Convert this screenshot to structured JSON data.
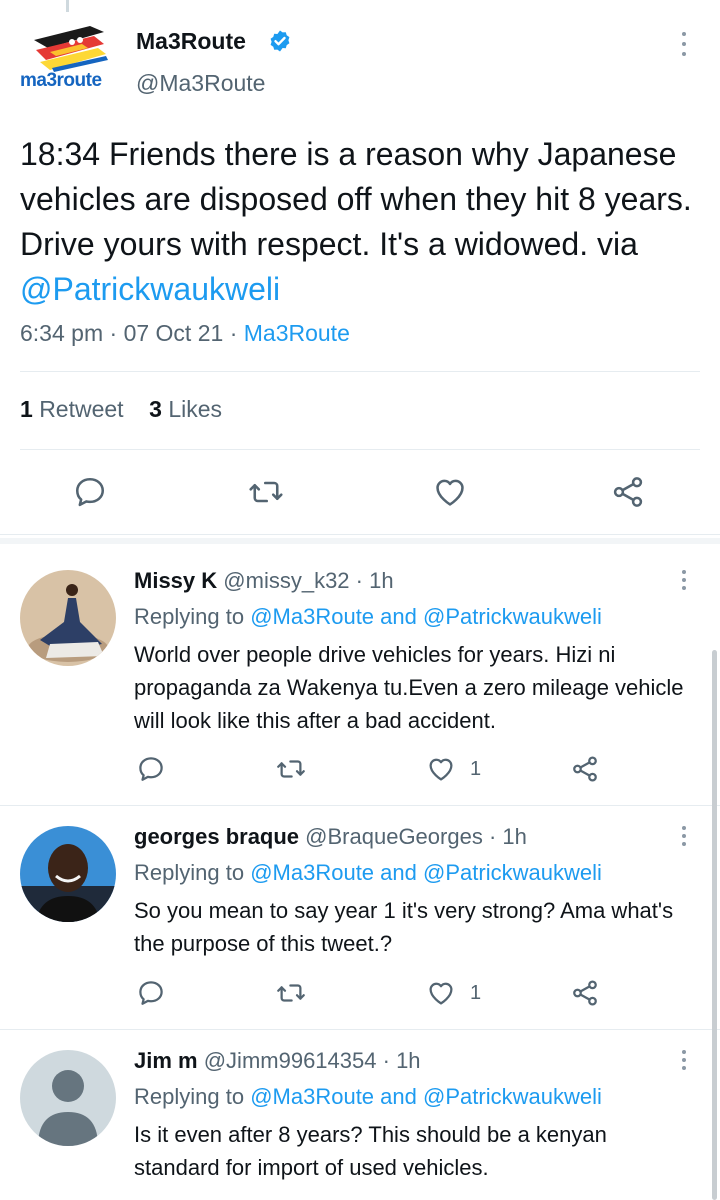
{
  "main_tweet": {
    "logo_text": "ma3route",
    "author_name": "Ma3Route",
    "author_handle": "@Ma3Route",
    "text_plain": "18:34 Friends there is a reason why Japanese vehicles are disposed off when they hit 8 years. Drive yours with respect. It's a widowed. via",
    "text_link": "@Patrickwaukweli",
    "time": "6:34 pm",
    "date": "07 Oct 21",
    "source": "Ma3Route",
    "retweet_count": "1",
    "retweet_label": "Retweet",
    "like_count": "3",
    "like_label": "Likes"
  },
  "replies": [
    {
      "name": "Missy K",
      "handle": "@missy_k32",
      "time": "1h",
      "replying_prefix": "Replying to",
      "mention1": "@Ma3Route",
      "and": "and",
      "mention2": "@Patrickwaukweli",
      "text": "World over people drive vehicles for years. Hizi ni propaganda za Wakenya tu.Even a zero mileage vehicle will look like this after a bad accident.",
      "like_count": "1"
    },
    {
      "name": "georges braque",
      "handle": "@BraqueGeorges",
      "time": "1h",
      "replying_prefix": "Replying to",
      "mention1": "@Ma3Route",
      "and": "and",
      "mention2": "@Patrickwaukweli",
      "text": "So you mean to say year 1 it's very strong? Ama what's the purpose of this tweet.?",
      "like_count": "1"
    },
    {
      "name": "Jim m",
      "handle": "@Jimm99614354",
      "time": "1h",
      "replying_prefix": "Replying to",
      "mention1": "@Ma3Route",
      "and": "and",
      "mention2": "@Patrickwaukweli",
      "text": "Is it even after 8 years? This should be a kenyan standard for import of used vehicles."
    }
  ],
  "icons": {
    "reply": "reply-icon",
    "retweet": "retweet-icon",
    "like": "heart-icon",
    "share": "share-icon",
    "more": "more-icon",
    "verified": "verified-badge-icon"
  },
  "colors": {
    "link": "#1d9bf0",
    "secondary_text": "#536471",
    "divider": "#e6ecf0"
  }
}
